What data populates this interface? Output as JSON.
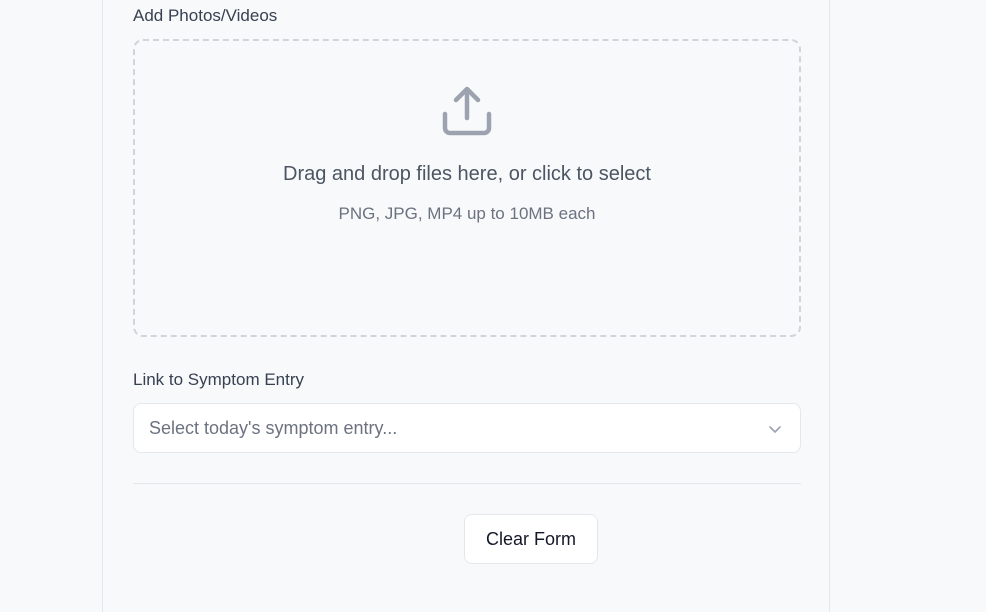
{
  "media": {
    "label": "Add Photos/Videos",
    "dropzone_title": "Drag and drop files here, or click to select",
    "dropzone_hint": "PNG, JPG, MP4 up to 10MB each",
    "icon": "upload-icon"
  },
  "symptom_link": {
    "label": "Link to Symptom Entry",
    "placeholder": "Select today's symptom entry...",
    "icon": "chevron-down-icon"
  },
  "actions": {
    "clear_label": "Clear Form"
  },
  "colors": {
    "background": "#f8f9fb",
    "border": "#e5e7eb",
    "icon": "#9ca3af",
    "text_muted": "#6b7280"
  }
}
